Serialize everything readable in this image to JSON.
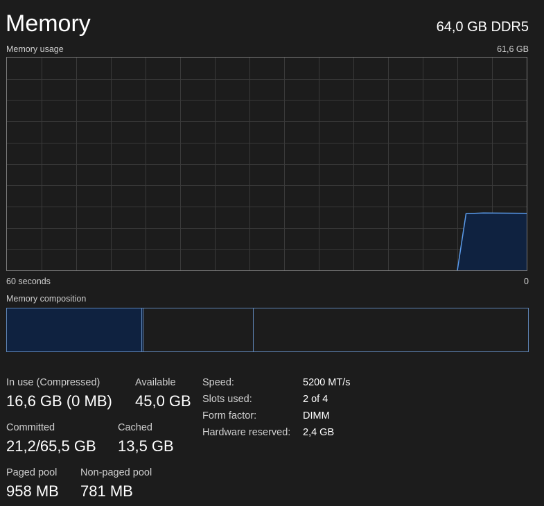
{
  "header": {
    "title": "Memory",
    "spec": "64,0 GB DDR5"
  },
  "usage_graph": {
    "label": "Memory usage",
    "max_label": "61,6 GB",
    "time_left": "60 seconds",
    "time_right": "0",
    "line_color": "#5b9bea",
    "fill_color": "#0f2240",
    "grid_color": "#3a3a3a",
    "chart_data": {
      "type": "area",
      "x_seconds_ago": [
        60,
        8,
        7,
        5,
        0
      ],
      "y_gb": [
        0,
        0,
        16.4,
        16.6,
        16.5
      ],
      "ylim": [
        0,
        61.6
      ],
      "xlim": [
        60,
        0
      ],
      "grid": true
    }
  },
  "composition": {
    "label": "Memory composition",
    "in_use_gb": 16.6,
    "modified_gb": 0.2,
    "standby_gb": 13.5,
    "total_gb": 64.0
  },
  "stats": {
    "in_use_label": "In use (Compressed)",
    "in_use_value": "16,6 GB (0 MB)",
    "available_label": "Available",
    "available_value": "45,0 GB",
    "committed_label": "Committed",
    "committed_value": "21,2/65,5 GB",
    "cached_label": "Cached",
    "cached_value": "13,5 GB",
    "paged_label": "Paged pool",
    "paged_value": "958 MB",
    "nonpaged_label": "Non-paged pool",
    "nonpaged_value": "781 MB"
  },
  "specs": {
    "speed_label": "Speed:",
    "speed_value": "5200 MT/s",
    "slots_label": "Slots used:",
    "slots_value": "2 of 4",
    "form_label": "Form factor:",
    "form_value": "DIMM",
    "reserved_label": "Hardware reserved:",
    "reserved_value": "2,4 GB"
  }
}
